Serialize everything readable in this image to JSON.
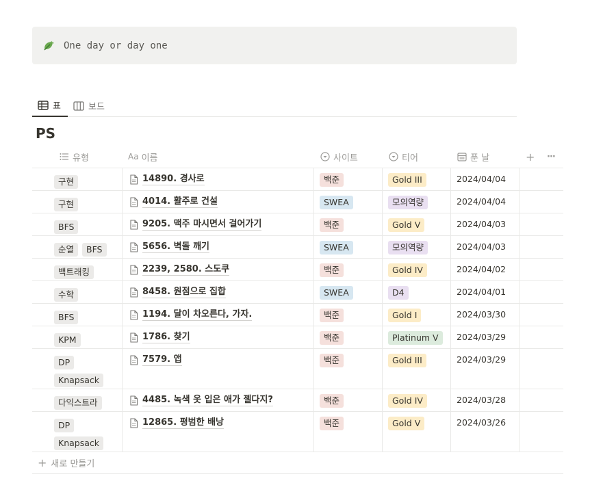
{
  "callout": {
    "text": "One day or day one",
    "icon": "leaf-icon"
  },
  "tabs": [
    {
      "label": "표",
      "icon": "table-icon",
      "active": true
    },
    {
      "label": "보드",
      "icon": "board-icon",
      "active": false
    }
  ],
  "database": {
    "title": "PS"
  },
  "columns": {
    "type": "유형",
    "name_prefix": "Aa",
    "name": "이름",
    "site": "사이트",
    "tier": "티어",
    "date": "푼 날"
  },
  "rows": [
    {
      "types": [
        "구현"
      ],
      "name": "14890. 경사로",
      "site": "백준",
      "site_color": "red",
      "tier": "Gold III",
      "tier_color": "yellow",
      "date": "2024/04/04"
    },
    {
      "types": [
        "구현"
      ],
      "name": "4014. 활주로 건설",
      "site": "SWEA",
      "site_color": "blue",
      "tier": "모의역량",
      "tier_color": "purple",
      "date": "2024/04/04"
    },
    {
      "types": [
        "BFS"
      ],
      "name": "9205. 맥주 마시면서 걸어가기",
      "site": "백준",
      "site_color": "red",
      "tier": "Gold V",
      "tier_color": "yellow",
      "date": "2024/04/03"
    },
    {
      "types": [
        "순열",
        "BFS"
      ],
      "name": "5656. 벽돌 깨기",
      "site": "SWEA",
      "site_color": "blue",
      "tier": "모의역량",
      "tier_color": "purple",
      "date": "2024/04/03"
    },
    {
      "types": [
        "백트래킹"
      ],
      "name": "2239, 2580. 스도쿠",
      "site": "백준",
      "site_color": "red",
      "tier": "Gold IV",
      "tier_color": "yellow",
      "date": "2024/04/02"
    },
    {
      "types": [
        "수학"
      ],
      "name": "8458. 원점으로 집합",
      "site": "SWEA",
      "site_color": "blue",
      "tier": "D4",
      "tier_color": "purple",
      "date": "2024/04/01"
    },
    {
      "types": [
        "BFS"
      ],
      "name": "1194. 달이 차오른다, 가자.",
      "site": "백준",
      "site_color": "red",
      "tier": "Gold I",
      "tier_color": "yellow",
      "date": "2024/03/30"
    },
    {
      "types": [
        "KPM"
      ],
      "name": "1786. 찾기",
      "site": "백준",
      "site_color": "red",
      "tier": "Platinum V",
      "tier_color": "green",
      "date": "2024/03/29"
    },
    {
      "types": [
        "DP",
        "Knapsack"
      ],
      "name": "7579. 앱",
      "site": "백준",
      "site_color": "red",
      "tier": "Gold III",
      "tier_color": "yellow",
      "date": "2024/03/29"
    },
    {
      "types": [
        "다익스트라"
      ],
      "name": "4485. 녹색 옷 입은 애가 젤다지?",
      "site": "백준",
      "site_color": "red",
      "tier": "Gold IV",
      "tier_color": "yellow",
      "date": "2024/03/28"
    },
    {
      "types": [
        "DP",
        "Knapsack"
      ],
      "name": "12865. 평범한 배낭",
      "site": "백준",
      "site_color": "red",
      "tier": "Gold V",
      "tier_color": "yellow",
      "date": "2024/03/26"
    }
  ],
  "new_row_label": "새로 만들기",
  "add_column_label": "+",
  "more_label": "···"
}
